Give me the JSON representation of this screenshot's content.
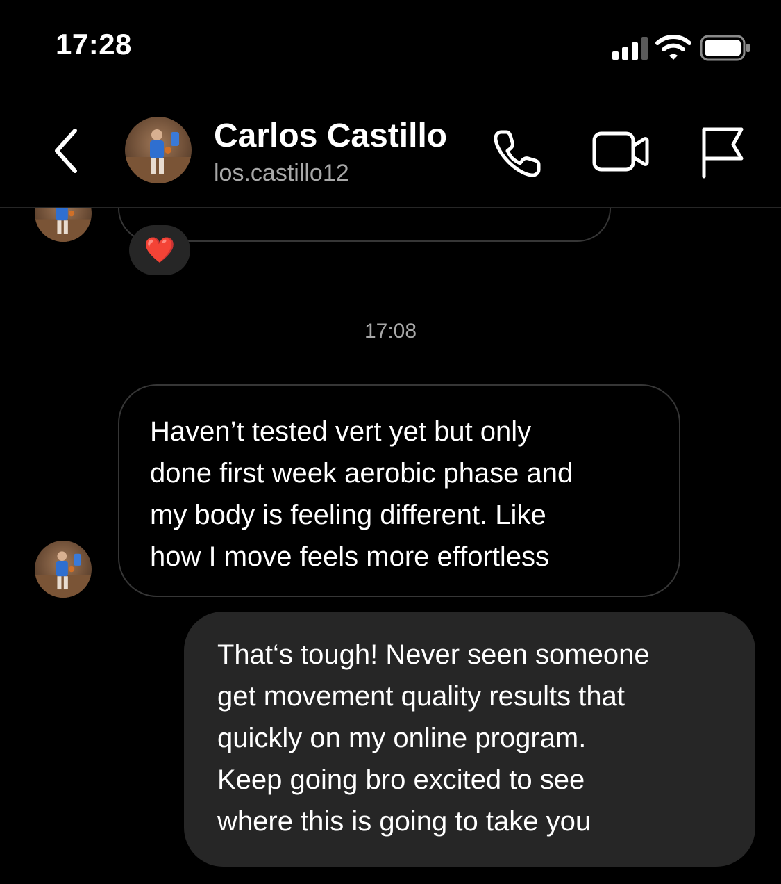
{
  "status_bar": {
    "time": "17:28",
    "signal_icon": "cellular-signal-icon",
    "wifi_icon": "wifi-icon",
    "battery_icon": "battery-icon"
  },
  "header": {
    "back_icon": "chevron-left-icon",
    "contact_name": "Carlos Castillo",
    "contact_handle": "los.castillo12",
    "call_icon": "phone-icon",
    "video_icon": "video-camera-icon",
    "flag_icon": "flag-icon"
  },
  "conversation": {
    "previous_message_reaction": "❤️",
    "timestamp": "17:08",
    "messages": [
      {
        "direction": "incoming",
        "text": "Haven’t tested vert yet but only\ndone first week aerobic phase and\nmy body is feeling different. Like\nhow I move feels more effortless"
      },
      {
        "direction": "outgoing",
        "text": "That‘s tough! Never seen someone\nget movement quality results that\nquickly on my online program.\nKeep going bro excited to see\nwhere this is going to take you"
      }
    ]
  },
  "colors": {
    "background": "#000000",
    "incoming_bubble_border": "#363636",
    "outgoing_bubble_fill": "#262626",
    "secondary_text": "#a8a8a8",
    "reaction_heart": "#ff2d3d"
  }
}
